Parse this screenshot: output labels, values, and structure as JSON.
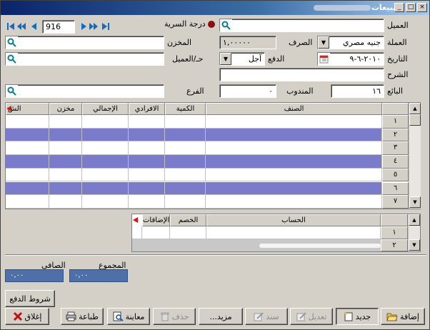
{
  "window": {
    "title": "مبيعات",
    "buttons": [
      "_",
      "□",
      "×"
    ]
  },
  "nav": {
    "record_number": "916"
  },
  "header": {
    "customer_label": "العميل",
    "customer_value": "",
    "quality_label": "درجة السرية",
    "currency_label": "العملة",
    "currency_value": "جنيه مصري",
    "exchange_label": "الصرف",
    "exchange_value": "١,٠٠٠٠٠",
    "warehouse_label": "المخزن",
    "warehouse_value": "",
    "date_label": "التاريخ",
    "date_value": "٢٠١٠-٦-٩",
    "payment_label": "الدفع",
    "payment_value": "آجل",
    "account_label": "حـ/العميل",
    "account_value": "",
    "description_label": "الشرح",
    "description_value": "",
    "seller_label": "البائع",
    "seller_value": "١٦",
    "rep_label": "المندوب",
    "rep_value": "٠",
    "branch_label": "الفرع",
    "branch_value": ""
  },
  "items_grid": {
    "columns": [
      "الصنف",
      "الكمية",
      "الافرادي",
      "الإجمالي",
      "مخزن",
      "الش"
    ],
    "rows": [
      "١",
      "٢",
      "٣",
      "٤",
      "٥",
      "٦",
      "٧"
    ],
    "highlight_color": "#7b7bcb"
  },
  "accounts_grid": {
    "columns": [
      "الحساب",
      "الخصم",
      "الإضافات"
    ],
    "rows": [
      "١",
      "٢"
    ]
  },
  "totals": {
    "sum_label": "المجموع",
    "sum_value": "٠,٠٠",
    "net_label": "الصافي",
    "net_value": "٠,٠٠"
  },
  "buttons": {
    "payment_terms": "شروط الدفع",
    "add": "إضافة",
    "new": "جديد",
    "edit": "تعديل",
    "voucher": "سند",
    "more": "مزيد...",
    "delete": "حذف",
    "preview": "معاينة",
    "print": "طباعة",
    "close": "إغلاق"
  }
}
